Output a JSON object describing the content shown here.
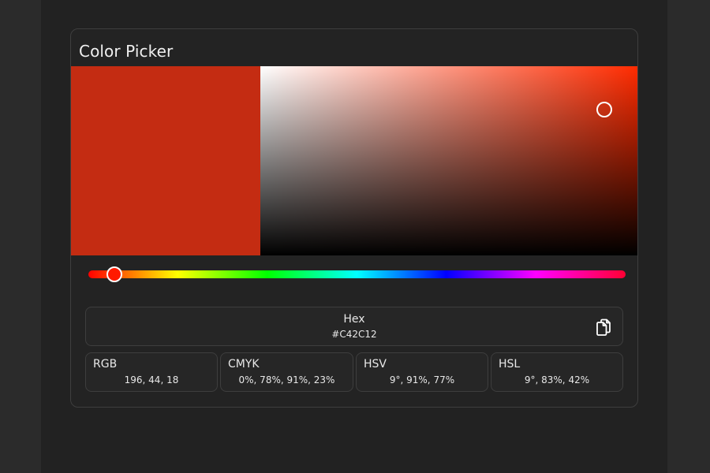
{
  "picker": {
    "title": "Color Picker",
    "current_color": "#C42C12",
    "hue_color": "#FF2B00",
    "saturation": 0.91,
    "value": 0.77,
    "hue": 9
  },
  "hex": {
    "label": "Hex",
    "value": "#C42C12",
    "copy_icon": "copy-icon"
  },
  "formats": [
    {
      "label": "RGB",
      "value": "196, 44, 18"
    },
    {
      "label": "CMYK",
      "value": "0%, 78%, 91%, 23%"
    },
    {
      "label": "HSV",
      "value": "9°, 91%, 77%"
    },
    {
      "label": "HSL",
      "value": "9°, 83%, 42%"
    }
  ]
}
